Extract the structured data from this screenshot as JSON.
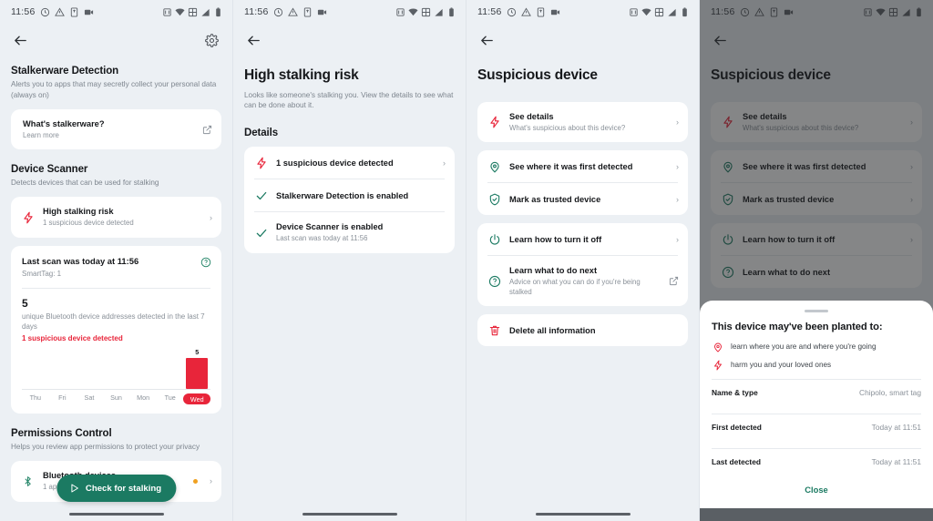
{
  "statusbar": {
    "time": "11:56",
    "left_icons": [
      "clock-icon",
      "warning-triangle-icon",
      "sim-card-icon",
      "video-icon"
    ],
    "right_icons": [
      "vibrate-icon",
      "wifi-icon",
      "screenshot-icon",
      "signal-icon",
      "battery-icon"
    ]
  },
  "screen1": {
    "appbar": {
      "back": "back-arrow-icon",
      "settings": "gear-icon"
    },
    "stalkerware": {
      "heading": "Stalkerware Detection",
      "description": "Alerts you to apps that may secretly collect your personal data (always on)",
      "card": {
        "title": "What's stalkerware?",
        "subtitle": "Learn more",
        "trailing_icon": "external-link-icon"
      }
    },
    "device_scanner": {
      "heading": "Device Scanner",
      "description": "Detects devices that can be used for stalking",
      "risk_card": {
        "icon": "lightning-bolt-icon",
        "title": "High stalking risk",
        "subtitle": "1 suspicious device detected",
        "chevron": "chevron-right-icon"
      },
      "scan_card": {
        "title": "Last scan was today at 11:56",
        "subtitle": "SmartTag: 1",
        "help_icon": "help-circle-icon",
        "count": "5",
        "count_desc": "unique Bluetooth device addresses detected in the last 7 days",
        "warning": "1 suspicious device detected"
      }
    },
    "permissions": {
      "heading": "Permissions Control",
      "description": "Helps you review app permissions to protect your privacy",
      "row": {
        "icon": "bluetooth-icon",
        "title": "Bluetooth devices",
        "subtitle": "1 app allowed",
        "dot_color": "#f0a020",
        "chevron": "chevron-right-icon"
      }
    },
    "fab": {
      "icon": "play-icon",
      "label": "Check for stalking"
    }
  },
  "screen2": {
    "title": "High stalking risk",
    "description": "Looks like someone's stalking you. View the details to see what can be done about it.",
    "details_heading": "Details",
    "rows": [
      {
        "icon": "lightning-bolt-icon",
        "title": "1 suspicious device detected",
        "subtitle": "",
        "trailing": "chevron"
      },
      {
        "icon": "check-icon",
        "title": "Stalkerware Detection is enabled",
        "subtitle": "",
        "trailing": ""
      },
      {
        "icon": "check-icon",
        "title": "Device Scanner is enabled",
        "subtitle": "Last scan was today at 11:56",
        "trailing": ""
      }
    ]
  },
  "screen3": {
    "title": "Suspicious device",
    "card1": [
      {
        "icon": "lightning-bolt-icon",
        "title": "See details",
        "subtitle": "What's suspicious about this device?",
        "trailing": "chevron"
      }
    ],
    "card2": [
      {
        "icon": "location-pin-icon",
        "title": "See where it was first detected",
        "subtitle": "",
        "trailing": "chevron"
      },
      {
        "icon": "shield-check-icon",
        "title": "Mark as trusted device",
        "subtitle": "",
        "trailing": "chevron"
      }
    ],
    "card3": [
      {
        "icon": "power-icon",
        "title": "Learn how to turn it off",
        "subtitle": "",
        "trailing": "chevron"
      },
      {
        "icon": "help-circle-icon",
        "title": "Learn what to do next",
        "subtitle": "Advice on what you can do if you're being stalked",
        "trailing": "external"
      }
    ],
    "card4": [
      {
        "icon": "trash-icon",
        "title": "Delete all information",
        "subtitle": "",
        "trailing": ""
      }
    ]
  },
  "screen4": {
    "title": "Suspicious device",
    "sheet": {
      "heading": "This device may've been planted to:",
      "reasons": [
        {
          "icon": "location-pin-icon",
          "label": "learn where you are and where you're going"
        },
        {
          "icon": "lightning-bolt-icon",
          "label": "harm you and your loved ones"
        }
      ],
      "fields": [
        {
          "key": "Name & type",
          "value": "Chipolo, smart tag"
        },
        {
          "key": "First detected",
          "value": "Today at 11:51"
        },
        {
          "key": "Last detected",
          "value": "Today at 11:51"
        }
      ],
      "close_label": "Close"
    }
  },
  "chart_data": {
    "type": "bar",
    "title": "unique Bluetooth device addresses detected in the last 7 days",
    "categories": [
      "Thu",
      "Fri",
      "Sat",
      "Sun",
      "Mon",
      "Tue",
      "Wed"
    ],
    "values": [
      0,
      0,
      0,
      0,
      0,
      0,
      5
    ],
    "value_labels": [
      "",
      "",
      "",
      "",
      "",
      "",
      "5"
    ],
    "highlight_category": "Wed",
    "bar_color": "#e8253a",
    "xlabel": "",
    "ylabel": "",
    "ylim": [
      0,
      5
    ],
    "grid": false,
    "legend": "none"
  },
  "colors": {
    "background": "#ecf0f4",
    "card": "#ffffff",
    "accent_green": "#1b7a62",
    "danger_red": "#e8253a",
    "text_primary": "#16181b",
    "text_secondary": "#8a9199"
  }
}
